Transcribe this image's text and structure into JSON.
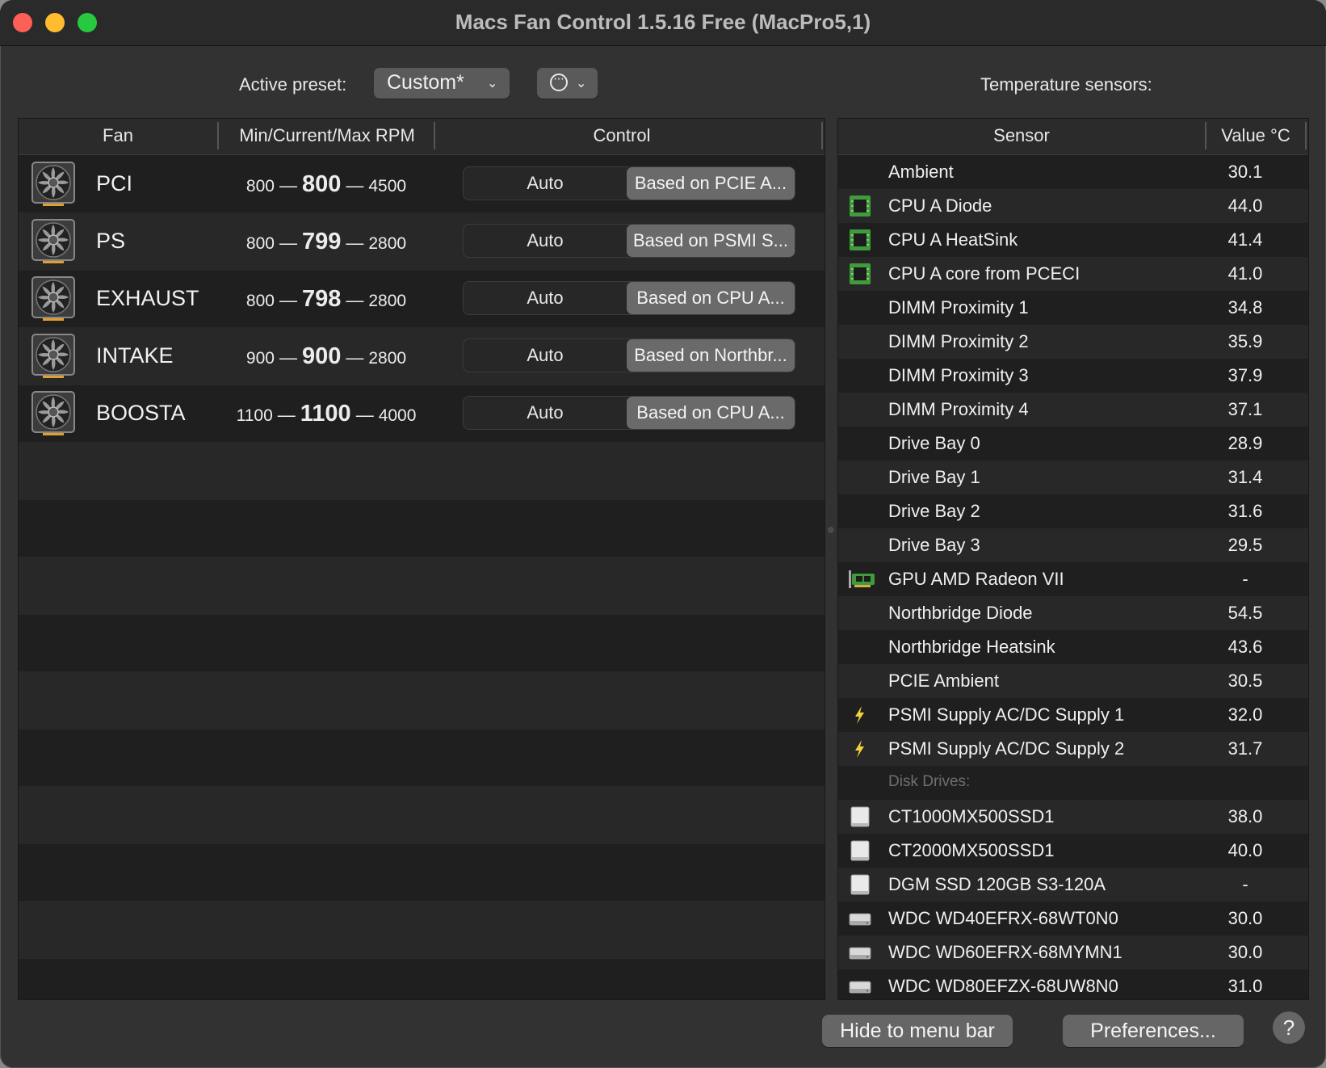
{
  "window": {
    "title": "Macs Fan Control 1.5.16 Free (MacPro5,1)"
  },
  "toolbar": {
    "preset_label": "Active preset:",
    "preset_value": "Custom*",
    "sensors_title": "Temperature sensors:"
  },
  "fan_table": {
    "headers": {
      "fan": "Fan",
      "rpm": "Min/Current/Max RPM",
      "control": "Control"
    },
    "rows": [
      {
        "name": "PCI",
        "min": "800",
        "current": "800",
        "max": "4500",
        "auto": "Auto",
        "based": "Based on PCIE A..."
      },
      {
        "name": "PS",
        "min": "800",
        "current": "799",
        "max": "2800",
        "auto": "Auto",
        "based": "Based on PSMI S..."
      },
      {
        "name": "EXHAUST",
        "min": "800",
        "current": "798",
        "max": "2800",
        "auto": "Auto",
        "based": "Based on CPU A..."
      },
      {
        "name": "INTAKE",
        "min": "900",
        "current": "900",
        "max": "2800",
        "auto": "Auto",
        "based": "Based on Northbr..."
      },
      {
        "name": "BOOSTA",
        "min": "1100",
        "current": "1100",
        "max": "4000",
        "auto": "Auto",
        "based": "Based on CPU A..."
      }
    ]
  },
  "sensor_table": {
    "headers": {
      "sensor": "Sensor",
      "value": "Value °C"
    },
    "rows": [
      {
        "name": "Ambient",
        "value": "30.1",
        "icon": "none"
      },
      {
        "name": "CPU A Diode",
        "value": "44.0",
        "icon": "cpu-chip"
      },
      {
        "name": "CPU A HeatSink",
        "value": "41.4",
        "icon": "cpu-chip"
      },
      {
        "name": "CPU A core from PCECI",
        "value": "41.0",
        "icon": "cpu-chip"
      },
      {
        "name": "DIMM Proximity 1",
        "value": "34.8",
        "icon": "none"
      },
      {
        "name": "DIMM Proximity 2",
        "value": "35.9",
        "icon": "none"
      },
      {
        "name": "DIMM Proximity 3",
        "value": "37.9",
        "icon": "none"
      },
      {
        "name": "DIMM Proximity 4",
        "value": "37.1",
        "icon": "none"
      },
      {
        "name": "Drive Bay 0",
        "value": "28.9",
        "icon": "none"
      },
      {
        "name": "Drive Bay 1",
        "value": "31.4",
        "icon": "none"
      },
      {
        "name": "Drive Bay 2",
        "value": "31.6",
        "icon": "none"
      },
      {
        "name": "Drive Bay 3",
        "value": "29.5",
        "icon": "none"
      },
      {
        "name": "GPU AMD Radeon VII",
        "value": "-",
        "icon": "gpu-card"
      },
      {
        "name": "Northbridge Diode",
        "value": "54.5",
        "icon": "none"
      },
      {
        "name": "Northbridge Heatsink",
        "value": "43.6",
        "icon": "none"
      },
      {
        "name": "PCIE Ambient",
        "value": "30.5",
        "icon": "none"
      },
      {
        "name": "PSMI Supply AC/DC Supply 1",
        "value": "32.0",
        "icon": "lightning-bolt"
      },
      {
        "name": "PSMI Supply AC/DC Supply 2",
        "value": "31.7",
        "icon": "lightning-bolt"
      }
    ],
    "disk_group_label": "Disk Drives:",
    "disks": [
      {
        "name": "CT1000MX500SSD1",
        "value": "38.0",
        "icon": "ssd"
      },
      {
        "name": "CT2000MX500SSD1",
        "value": "40.0",
        "icon": "ssd"
      },
      {
        "name": "DGM SSD 120GB S3-120A",
        "value": "-",
        "icon": "ssd"
      },
      {
        "name": "WDC WD40EFRX-68WT0N0",
        "value": "30.0",
        "icon": "hard-drive"
      },
      {
        "name": "WDC WD60EFRX-68MYMN1",
        "value": "30.0",
        "icon": "hard-drive"
      },
      {
        "name": "WDC WD80EFZX-68UW8N0",
        "value": "31.0",
        "icon": "hard-drive"
      }
    ]
  },
  "footer": {
    "hide_label": "Hide to menu bar",
    "prefs_label": "Preferences...",
    "help_label": "?"
  }
}
